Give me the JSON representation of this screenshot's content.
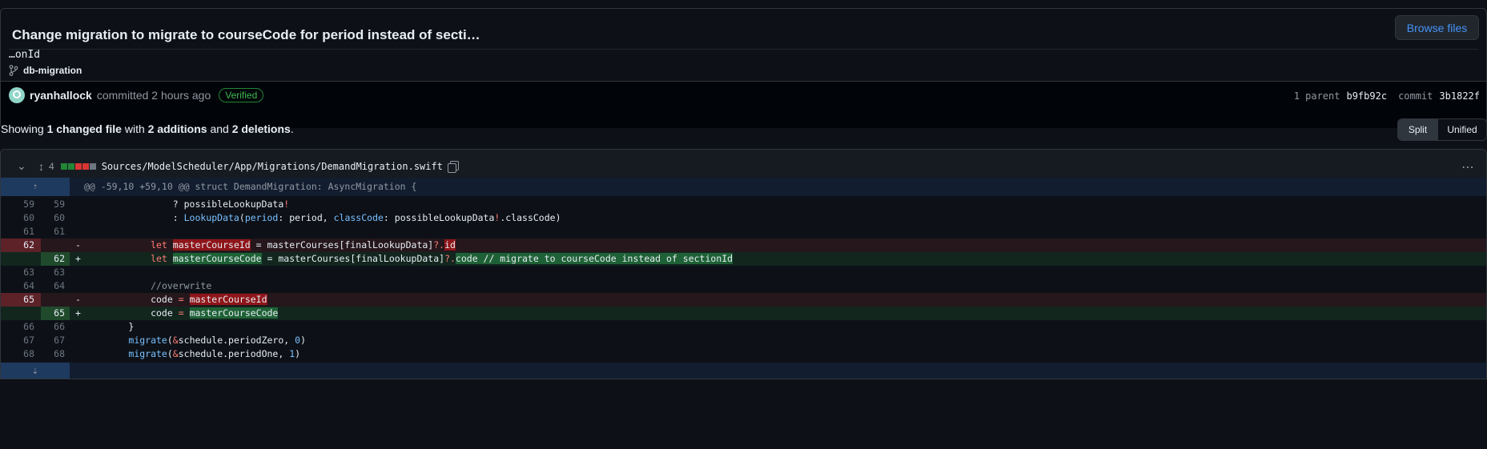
{
  "commit": {
    "title": "Change migration to migrate to courseCode for period instead of secti…",
    "description": "…onId",
    "browse_label": "Browse files",
    "branch": "db-migration",
    "author": "ryanhallock",
    "committed_text": "committed 2 hours ago",
    "verified_label": "Verified",
    "parent_label": "1 parent",
    "parent_sha": "b9fb92c",
    "commit_label": "commit",
    "commit_sha": "3b1822f"
  },
  "summary": {
    "prefix": "Showing",
    "files": "1 changed file",
    "with": "with",
    "additions": "2 additions",
    "and": "and",
    "deletions": "2 deletions",
    "end": "."
  },
  "view": {
    "split_label": "Split",
    "unified_label": "Unified"
  },
  "file": {
    "change_count": "4",
    "path": "Sources/ModelScheduler/App/Migrations/DemandMigration.swift",
    "diffstat_colors": [
      "#238636",
      "#238636",
      "#da3633",
      "#da3633",
      "#6e7681"
    ]
  },
  "hunk_header": "@@ -59,10 +59,10 @@ struct DemandMigration: AsyncMigration {",
  "lines": [
    {
      "type": "ctx",
      "old": "59",
      "new": "59",
      "sign": "",
      "segs": [
        [
          "",
          "                ? "
        ],
        [
          "",
          "possibleLookupData"
        ],
        [
          "kw",
          "!"
        ]
      ]
    },
    {
      "type": "ctx",
      "old": "60",
      "new": "60",
      "sign": "",
      "segs": [
        [
          "",
          "                : "
        ],
        [
          "fn",
          "LookupData"
        ],
        [
          "",
          "("
        ],
        [
          "fn",
          "period"
        ],
        [
          "",
          ": period, "
        ],
        [
          "fn",
          "classCode"
        ],
        [
          "",
          ": possibleLookupData"
        ],
        [
          "kw",
          "!"
        ],
        [
          "",
          ".classCode)"
        ]
      ]
    },
    {
      "type": "ctx",
      "old": "61",
      "new": "61",
      "sign": "",
      "segs": [
        [
          "",
          ""
        ]
      ]
    },
    {
      "type": "del",
      "old": "62",
      "new": "",
      "sign": "-",
      "segs": [
        [
          "",
          "            "
        ],
        [
          "kw",
          "let "
        ],
        [
          "hl-del",
          "masterCourseId"
        ],
        [
          "",
          " = masterCourses[finalLookupData]"
        ],
        [
          "kw",
          "?."
        ],
        [
          "hl-del",
          "id"
        ]
      ]
    },
    {
      "type": "add",
      "old": "",
      "new": "62",
      "sign": "+",
      "segs": [
        [
          "",
          "            "
        ],
        [
          "kw",
          "let "
        ],
        [
          "hl-add",
          "masterCourseCode"
        ],
        [
          "",
          " = masterCourses[finalLookupData]"
        ],
        [
          "kw",
          "?."
        ],
        [
          "hl-add",
          "code // migrate to courseCode instead of sectionId"
        ]
      ]
    },
    {
      "type": "ctx",
      "old": "63",
      "new": "63",
      "sign": "",
      "segs": [
        [
          "",
          ""
        ]
      ]
    },
    {
      "type": "ctx",
      "old": "64",
      "new": "64",
      "sign": "",
      "segs": [
        [
          "",
          "            "
        ],
        [
          "cm",
          "//overwrite"
        ]
      ]
    },
    {
      "type": "del",
      "old": "65",
      "new": "",
      "sign": "-",
      "segs": [
        [
          "",
          "            code "
        ],
        [
          "kw",
          "="
        ],
        [
          "",
          " "
        ],
        [
          "hl-del",
          "masterCourseId"
        ]
      ]
    },
    {
      "type": "add",
      "old": "",
      "new": "65",
      "sign": "+",
      "segs": [
        [
          "",
          "            code "
        ],
        [
          "kw",
          "="
        ],
        [
          "",
          " "
        ],
        [
          "hl-add",
          "masterCourseCode"
        ]
      ]
    },
    {
      "type": "ctx",
      "old": "66",
      "new": "66",
      "sign": "",
      "segs": [
        [
          "",
          "        }"
        ]
      ]
    },
    {
      "type": "ctx",
      "old": "67",
      "new": "67",
      "sign": "",
      "segs": [
        [
          "",
          "        "
        ],
        [
          "fn",
          "migrate"
        ],
        [
          "",
          "("
        ],
        [
          "kw",
          "&"
        ],
        [
          "",
          "schedule.periodZero, "
        ],
        [
          "fn",
          "0"
        ],
        [
          "",
          ")"
        ]
      ]
    },
    {
      "type": "ctx",
      "old": "68",
      "new": "68",
      "sign": "",
      "segs": [
        [
          "",
          "        "
        ],
        [
          "fn",
          "migrate"
        ],
        [
          "",
          "("
        ],
        [
          "kw",
          "&"
        ],
        [
          "",
          "schedule.periodOne, "
        ],
        [
          "fn",
          "1"
        ],
        [
          "",
          ")"
        ]
      ]
    }
  ]
}
